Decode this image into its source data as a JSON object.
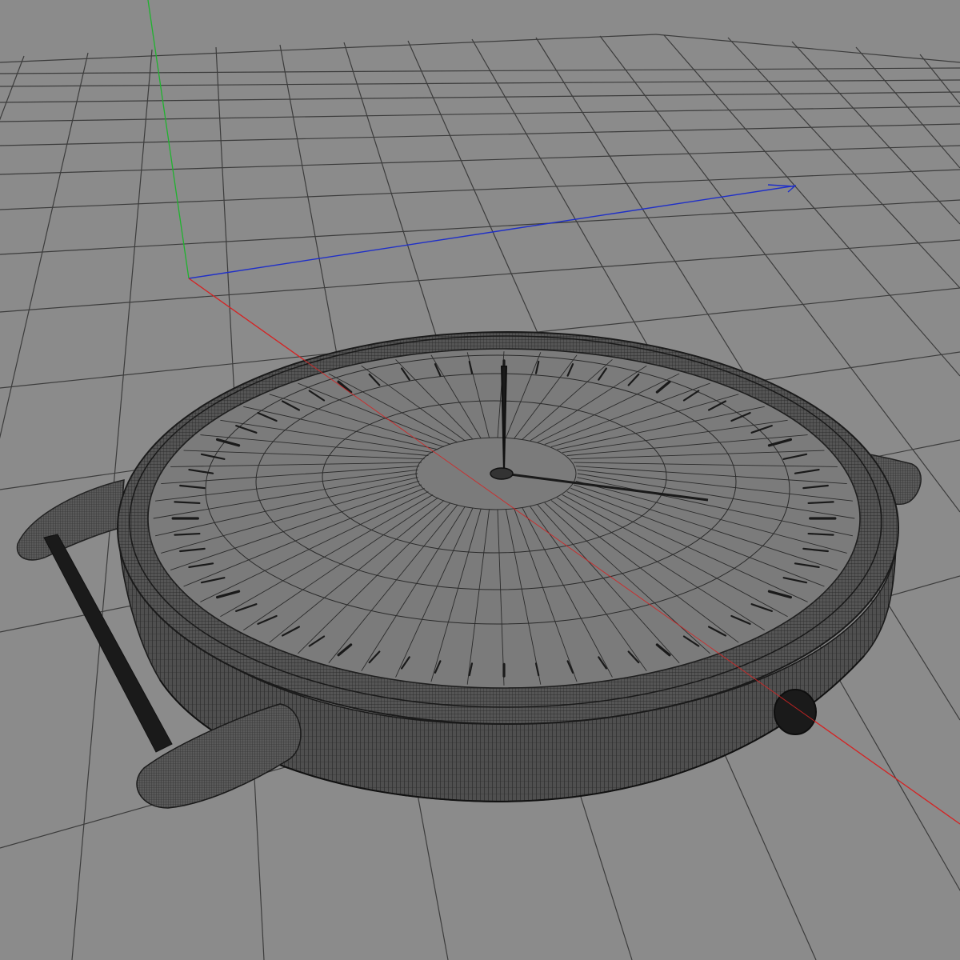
{
  "viewport": {
    "background": "#8b8b8b",
    "grid_color": "#3a3a3a",
    "axis_x_color": "#d02020",
    "axis_y_color": "#20b030",
    "axis_z_color": "#2030c8"
  },
  "model": {
    "wire_color": "#1e1e1e",
    "dial_color": "#7a7a7a",
    "case_color": "#4a4a4a",
    "tick_count": 60
  }
}
